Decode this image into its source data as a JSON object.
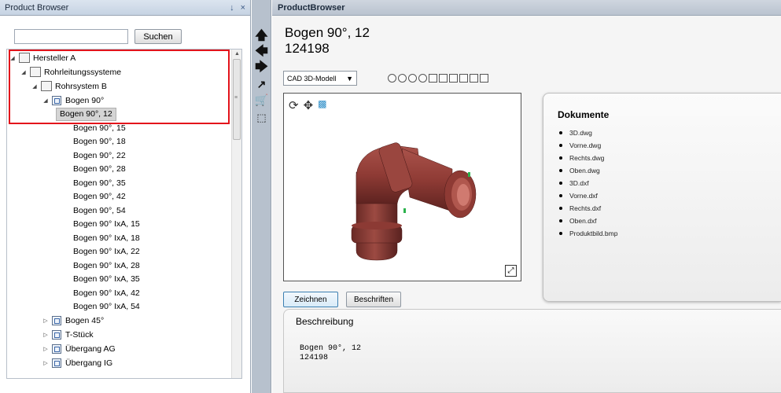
{
  "left_panel": {
    "title": "Product Browser",
    "pin": "p",
    "close": "×"
  },
  "search": {
    "value": "",
    "button_label": "Suchen"
  },
  "tree": {
    "manufacturer": "Hersteller A",
    "category": "Rohrleitungssysteme",
    "system": "Rohrsystem B",
    "part_group": "Bogen 90°",
    "items": [
      "Bogen 90°, 12",
      "Bogen 90°, 15",
      "Bogen 90°, 18",
      "Bogen 90°, 22",
      "Bogen 90°, 28",
      "Bogen 90°, 35",
      "Bogen 90°, 42",
      "Bogen 90°, 54",
      "Bogen 90° IxA, 15",
      "Bogen 90° IxA, 18",
      "Bogen 90° IxA, 22",
      "Bogen 90° IxA, 28",
      "Bogen 90° IxA, 35",
      "Bogen 90° IxA, 42",
      "Bogen 90° IxA, 54"
    ],
    "selected_index": 0,
    "other_groups": [
      "Bogen 45°",
      "T-Stück",
      "Übergang AG",
      "Übergang IG"
    ]
  },
  "right_panel": {
    "title": "ProductBrowser",
    "product_name": "Bogen 90°, 12",
    "product_number": "124198",
    "view_mode": "CAD 3D-Modell"
  },
  "buttons": {
    "draw": "Zeichnen",
    "label": "Beschriften"
  },
  "documents": {
    "heading": "Dokumente",
    "files": [
      "3D.dwg",
      "Vorne.dwg",
      "Rechts.dwg",
      "Oben.dwg",
      "3D.dxf",
      "Vorne.dxf",
      "Rechts.dxf",
      "Oben.dxf",
      "Produktbild.bmp"
    ]
  },
  "description": {
    "heading": "Beschreibung",
    "line1": "Bogen 90°, 12",
    "line2": "124198"
  },
  "colors": {
    "model": "#8f3b35",
    "highlight": "#e3141b",
    "accent_button": "#3c7fb1"
  }
}
